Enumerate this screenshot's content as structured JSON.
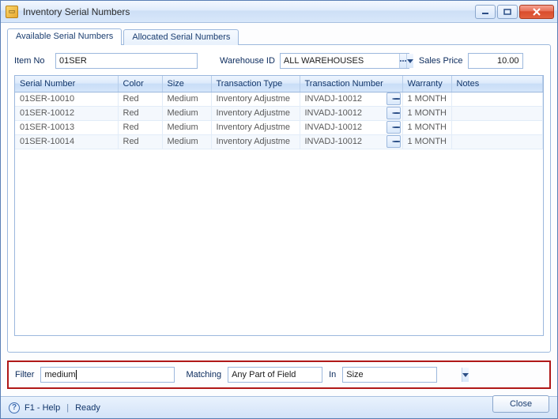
{
  "window": {
    "title": "Inventory Serial Numbers"
  },
  "tabs": {
    "available": "Available Serial Numbers",
    "allocated": "Allocated Serial Numbers"
  },
  "fields": {
    "item_no_label": "Item No",
    "item_no_value": "01SER",
    "warehouse_label": "Warehouse ID",
    "warehouse_value": "ALL WAREHOUSES",
    "sales_price_label": "Sales Price",
    "sales_price_value": "10.00"
  },
  "columns": {
    "serial": "Serial Number",
    "color": "Color",
    "size": "Size",
    "txn_type": "Transaction Type",
    "txn_num": "Transaction Number",
    "warranty": "Warranty",
    "notes": "Notes"
  },
  "rows": [
    {
      "serial": "01SER-10010",
      "color": "Red",
      "size": "Medium",
      "txn_type": "Inventory Adjustme",
      "txn_num": "INVADJ-10012",
      "warranty": "1 MONTH",
      "notes": ""
    },
    {
      "serial": "01SER-10012",
      "color": "Red",
      "size": "Medium",
      "txn_type": "Inventory Adjustme",
      "txn_num": "INVADJ-10012",
      "warranty": "1 MONTH",
      "notes": ""
    },
    {
      "serial": "01SER-10013",
      "color": "Red",
      "size": "Medium",
      "txn_type": "Inventory Adjustme",
      "txn_num": "INVADJ-10012",
      "warranty": "1 MONTH",
      "notes": ""
    },
    {
      "serial": "01SER-10014",
      "color": "Red",
      "size": "Medium",
      "txn_type": "Inventory Adjustme",
      "txn_num": "INVADJ-10012",
      "warranty": "1 MONTH",
      "notes": ""
    }
  ],
  "filter": {
    "filter_label": "Filter",
    "filter_value": "medium",
    "matching_label": "Matching",
    "matching_value": "Any Part of Field",
    "in_label": "In",
    "in_value": "Size"
  },
  "buttons": {
    "close": "Close"
  },
  "status": {
    "help": "F1 - Help",
    "ready": "Ready"
  }
}
